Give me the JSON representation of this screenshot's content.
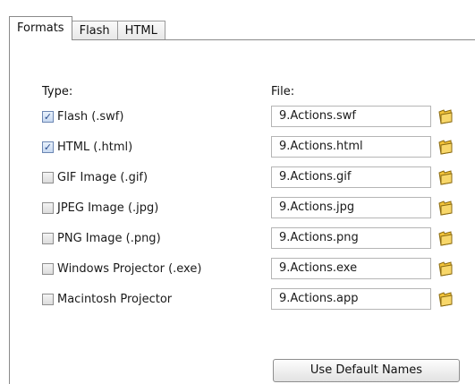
{
  "tabs": [
    {
      "label": "Formats",
      "active": true
    },
    {
      "label": "Flash",
      "active": false
    },
    {
      "label": "HTML",
      "active": false
    }
  ],
  "labels": {
    "type": "Type:",
    "file": "File:"
  },
  "formats": [
    {
      "label": "Flash  (.swf)",
      "checked": true,
      "file": "9.Actions.swf"
    },
    {
      "label": "HTML (.html)",
      "checked": true,
      "file": "9.Actions.html"
    },
    {
      "label": "GIF Image (.gif)",
      "checked": false,
      "file": "9.Actions.gif"
    },
    {
      "label": "JPEG Image (.jpg)",
      "checked": false,
      "file": "9.Actions.jpg"
    },
    {
      "label": "PNG Image (.png)",
      "checked": false,
      "file": "9.Actions.png"
    },
    {
      "label": "Windows Projector (.exe)",
      "checked": false,
      "file": "9.Actions.exe"
    },
    {
      "label": "Macintosh Projector",
      "checked": false,
      "file": "9.Actions.app"
    }
  ],
  "default_button": "Use Default Names",
  "icons": {
    "folder": "folder-icon",
    "checkmark": "✓"
  },
  "colors": {
    "folder_fill": "#f3c43a",
    "folder_stroke": "#8a6a10"
  }
}
